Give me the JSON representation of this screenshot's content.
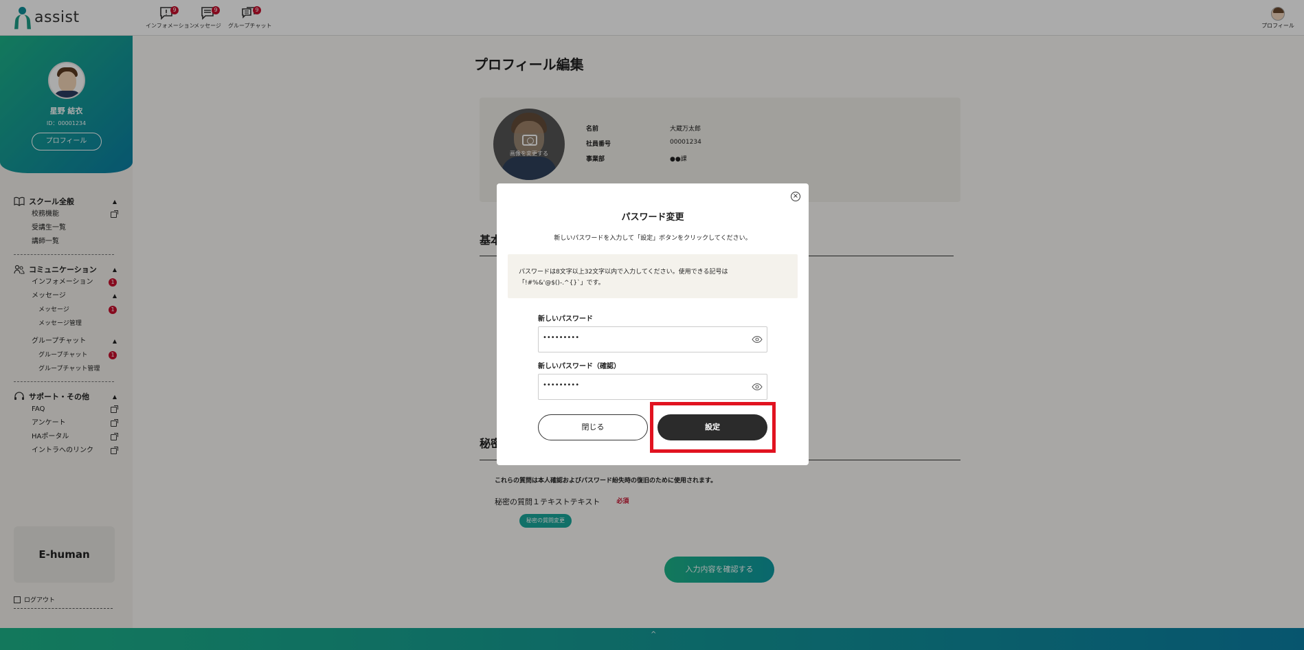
{
  "header": {
    "logo_text": "assist",
    "nav": [
      {
        "label": "インフォメーション",
        "badge": "9"
      },
      {
        "label": "メッセージ",
        "badge": "9"
      },
      {
        "label": "グループチャット",
        "badge": "9"
      }
    ],
    "profile_label": "プロフィール"
  },
  "sidebar": {
    "user_name": "星野 結衣",
    "user_id": "ID：00001234",
    "profile_button": "プロフィール",
    "sections": {
      "school": {
        "title": "スクール全般",
        "items": [
          "校務機能",
          "受講生一覧",
          "講師一覧"
        ]
      },
      "communication": {
        "title": "コミュニケーション",
        "information": "インフォメーション",
        "information_badge": "1",
        "message": "メッセージ",
        "message_sub": "メッセージ",
        "message_sub_badge": "1",
        "message_manage": "メッセージ管理",
        "group_chat": "グループチャット",
        "group_chat_sub": "グループチャット",
        "group_chat_sub_badge": "1",
        "group_chat_manage": "グループチャット管理"
      },
      "support": {
        "title": "サポート・その他",
        "items": [
          "FAQ",
          "アンケート",
          "HAポータル",
          "イントラへのリンク"
        ]
      }
    },
    "brand_box": "E-human",
    "logout": "ログアウト"
  },
  "main": {
    "page_title": "プロフィール編集",
    "photo_change": "画像を変更する",
    "info": [
      {
        "key": "名前",
        "value": "大蔵万太郎"
      },
      {
        "key": "社員番号",
        "value": "00001234"
      },
      {
        "key": "事業部",
        "value": "●●課"
      }
    ],
    "section_basic": "基本",
    "section_secret": "秘密",
    "secret_note": "これらの質問は本人確認およびパスワード紛失時の復旧のために使用されます。",
    "secret_q1": "秘密の質問１テキストテキスト",
    "required": "必須",
    "secret_change_button": "秘密の質問変更",
    "confirm_button": "入力内容を確認する"
  },
  "modal": {
    "close_symbol": "×",
    "title": "パスワード変更",
    "description": "新しいパスワードを入力して「設定」ボタンをクリックしてください。",
    "info_text": "パスワードは8文字以上32文字以内で入力してください。使用できる記号は「!#%&'@$()-.^{}`」です。",
    "new_password_label": "新しいパスワード",
    "new_password_value": "•••••••••",
    "confirm_password_label": "新しいパスワード（確認）",
    "confirm_password_value": "•••••••••",
    "close_button": "閉じる",
    "set_button": "設定"
  },
  "footer": {
    "up_arrow": "^"
  },
  "colors": {
    "accent_green": "#1db489",
    "accent_teal": "#0b7fa5",
    "badge_red": "#c8102e",
    "highlight_red": "#e11320",
    "dark_button": "#2b2b2b"
  }
}
